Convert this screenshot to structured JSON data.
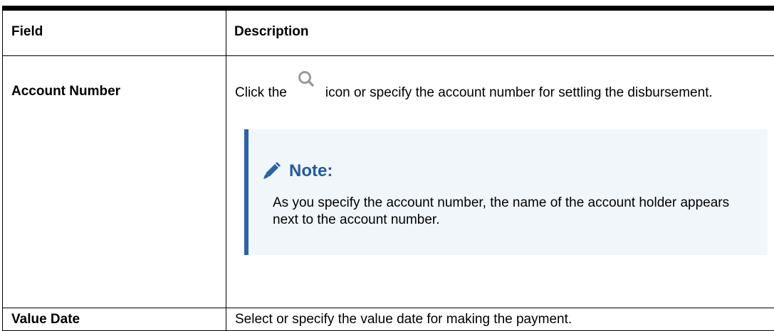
{
  "table": {
    "header": {
      "field": "Field",
      "description": "Description"
    },
    "rows": [
      {
        "field": "Account Number",
        "description_before_icon": "Click the",
        "inline_icon": "search-icon",
        "description_after_icon": "icon or specify the account number for settling the disbursement.",
        "note": {
          "icon": "pencil-icon",
          "title": "Note:",
          "text": "As you specify the account number, the name of the account holder appears next to the account number."
        }
      },
      {
        "field": "Value Date",
        "description": "Select or specify the value date for making the payment."
      }
    ]
  },
  "colors": {
    "note_accent": "#2a62ab",
    "note_background": "#f1f6fb",
    "note_title": "#1f5aa6",
    "icon_gray": "#9a9a9a"
  }
}
